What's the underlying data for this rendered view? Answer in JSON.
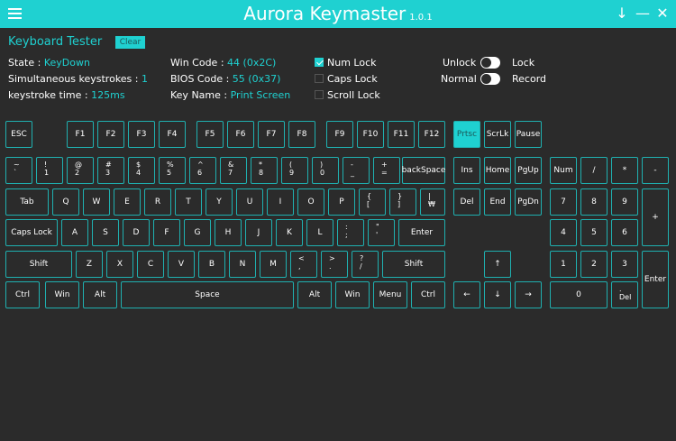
{
  "titlebar": {
    "title": "Aurora Keymaster",
    "version": "1.0.1",
    "down_icon": "↓",
    "minimize_icon": "—",
    "close_icon": "✕"
  },
  "panel": {
    "title": "Keyboard Tester",
    "clear_label": "Clear"
  },
  "info": {
    "state_label": "State :",
    "state_value": "KeyDown",
    "simul_label": "Simultaneous keystrokes :",
    "simul_value": "1",
    "time_label": "keystroke time :",
    "time_value": "125ms",
    "win_code_label": "Win Code :",
    "win_code_value": "44 (0x2C)",
    "bios_code_label": "BIOS Code :",
    "bios_code_value": "55 (0x37)",
    "key_name_label": "Key Name :",
    "key_name_value": "Print Screen"
  },
  "locks": [
    {
      "label": "Num Lock",
      "checked": true
    },
    {
      "label": "Caps Lock",
      "checked": false
    },
    {
      "label": "Scroll Lock",
      "checked": false
    }
  ],
  "toggles": [
    {
      "left": "Unlock",
      "right": "Lock"
    },
    {
      "left": "Normal",
      "right": "Record"
    }
  ],
  "keys": [
    {
      "n": "esc",
      "t": "ESC"
    },
    {
      "n": "f1",
      "t": "F1"
    },
    {
      "n": "f2",
      "t": "F2"
    },
    {
      "n": "f3",
      "t": "F3"
    },
    {
      "n": "f4",
      "t": "F4"
    },
    {
      "n": "f5",
      "t": "F5"
    },
    {
      "n": "f6",
      "t": "F6"
    },
    {
      "n": "f7",
      "t": "F7"
    },
    {
      "n": "f8",
      "t": "F8"
    },
    {
      "n": "f9",
      "t": "F9"
    },
    {
      "n": "f10",
      "t": "F10"
    },
    {
      "n": "f11",
      "t": "F11"
    },
    {
      "n": "f12",
      "t": "F12"
    },
    {
      "n": "prtsc",
      "t": "Prtsc",
      "active": true
    },
    {
      "n": "scrlk",
      "t": "ScrLk"
    },
    {
      "n": "pause",
      "t": "Pause"
    },
    {
      "n": "backtick",
      "t1": "~",
      "t2": "`"
    },
    {
      "n": "1",
      "t1": "!",
      "t2": "1"
    },
    {
      "n": "2",
      "t1": "@",
      "t2": "2"
    },
    {
      "n": "3",
      "t1": "#",
      "t2": "3"
    },
    {
      "n": "4",
      "t1": "$",
      "t2": "4"
    },
    {
      "n": "5",
      "t1": "%",
      "t2": "5"
    },
    {
      "n": "6",
      "t1": "^",
      "t2": "6"
    },
    {
      "n": "7",
      "t1": "&",
      "t2": "7"
    },
    {
      "n": "8",
      "t1": "*",
      "t2": "8"
    },
    {
      "n": "9",
      "t1": "(",
      "t2": "9"
    },
    {
      "n": "0",
      "t1": ")",
      "t2": "0"
    },
    {
      "n": "minus",
      "t1": "-",
      "t2": "_"
    },
    {
      "n": "equals",
      "t1": "+",
      "t2": "="
    },
    {
      "n": "backspace",
      "t": "backSpace"
    },
    {
      "n": "ins",
      "t": "Ins"
    },
    {
      "n": "home",
      "t": "Home"
    },
    {
      "n": "pgup",
      "t": "PgUp"
    },
    {
      "n": "numlock",
      "t": "Num"
    },
    {
      "n": "num-divide",
      "t": "/"
    },
    {
      "n": "num-multiply",
      "t": "*"
    },
    {
      "n": "num-minus",
      "t": "-"
    },
    {
      "n": "tab",
      "t": "Tab"
    },
    {
      "n": "q",
      "t": "Q"
    },
    {
      "n": "w",
      "t": "W"
    },
    {
      "n": "e",
      "t": "E"
    },
    {
      "n": "r",
      "t": "R"
    },
    {
      "n": "t",
      "t": "T"
    },
    {
      "n": "y",
      "t": "Y"
    },
    {
      "n": "u",
      "t": "U"
    },
    {
      "n": "i",
      "t": "I"
    },
    {
      "n": "o",
      "t": "O"
    },
    {
      "n": "p",
      "t": "P"
    },
    {
      "n": "lbracket",
      "t1": "{",
      "t2": "["
    },
    {
      "n": "rbracket",
      "t1": "}",
      "t2": "]"
    },
    {
      "n": "backslash",
      "t1": "|",
      "t2": "₩"
    },
    {
      "n": "del",
      "t": "Del"
    },
    {
      "n": "end",
      "t": "End"
    },
    {
      "n": "pgdn",
      "t": "PgDn"
    },
    {
      "n": "num7",
      "t": "7"
    },
    {
      "n": "num8",
      "t": "8"
    },
    {
      "n": "num9",
      "t": "9"
    },
    {
      "n": "num-plus",
      "t": "+"
    },
    {
      "n": "capslock",
      "t": "Caps Lock"
    },
    {
      "n": "a",
      "t": "A"
    },
    {
      "n": "s",
      "t": "S"
    },
    {
      "n": "d",
      "t": "D"
    },
    {
      "n": "f",
      "t": "F"
    },
    {
      "n": "g",
      "t": "G"
    },
    {
      "n": "h",
      "t": "H"
    },
    {
      "n": "j",
      "t": "J"
    },
    {
      "n": "k",
      "t": "K"
    },
    {
      "n": "l",
      "t": "L"
    },
    {
      "n": "semicolon",
      "t1": ":",
      "t2": ";"
    },
    {
      "n": "quote",
      "t1": "\"",
      "t2": "'"
    },
    {
      "n": "enter",
      "t": "Enter"
    },
    {
      "n": "num4",
      "t": "4"
    },
    {
      "n": "num5",
      "t": "5"
    },
    {
      "n": "num6",
      "t": "6"
    },
    {
      "n": "lshift",
      "t": "Shift"
    },
    {
      "n": "z",
      "t": "Z"
    },
    {
      "n": "x",
      "t": "X"
    },
    {
      "n": "c",
      "t": "C"
    },
    {
      "n": "v",
      "t": "V"
    },
    {
      "n": "b",
      "t": "B"
    },
    {
      "n": "n",
      "t": "N"
    },
    {
      "n": "m",
      "t": "M"
    },
    {
      "n": "comma",
      "t1": "<",
      "t2": ","
    },
    {
      "n": "period",
      "t1": ">",
      "t2": "."
    },
    {
      "n": "slash",
      "t1": "?",
      "t2": "/"
    },
    {
      "n": "rshift",
      "t": "Shift"
    },
    {
      "n": "up",
      "t": "↑"
    },
    {
      "n": "num1",
      "t": "1"
    },
    {
      "n": "num2",
      "t": "2"
    },
    {
      "n": "num3",
      "t": "3"
    },
    {
      "n": "num-enter",
      "t": "Enter"
    },
    {
      "n": "lctrl",
      "t": "Ctrl"
    },
    {
      "n": "lwin",
      "t": "Win"
    },
    {
      "n": "lalt",
      "t": "Alt"
    },
    {
      "n": "space",
      "t": "Space"
    },
    {
      "n": "ralt",
      "t": "Alt"
    },
    {
      "n": "rwin",
      "t": "Win"
    },
    {
      "n": "menu",
      "t": "Menu"
    },
    {
      "n": "rctrl",
      "t": "Ctrl"
    },
    {
      "n": "left",
      "t": "←"
    },
    {
      "n": "down",
      "t": "↓"
    },
    {
      "n": "right",
      "t": "→"
    },
    {
      "n": "num0",
      "t": "0"
    },
    {
      "n": "num-del",
      "t1": ".",
      "t2": "Del"
    }
  ],
  "colors": {
    "accent": "#1fd1d1",
    "background": "#2b2b2b",
    "key_border": "#1fb0b0"
  }
}
